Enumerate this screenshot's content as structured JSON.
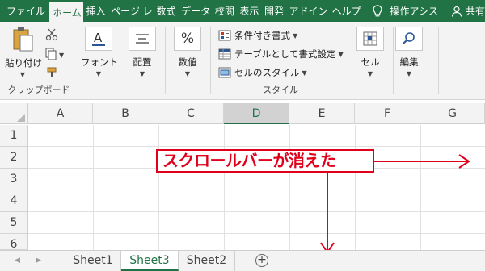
{
  "tabs": [
    {
      "label": "ファイル"
    },
    {
      "label": "ホーム"
    },
    {
      "label": "挿入"
    },
    {
      "label": "ページ レ"
    },
    {
      "label": "数式"
    },
    {
      "label": "データ"
    },
    {
      "label": "校閲"
    },
    {
      "label": "表示"
    },
    {
      "label": "開発"
    },
    {
      "label": "アドイン"
    },
    {
      "label": "ヘルプ"
    }
  ],
  "tell_me": "操作アシス",
  "share": "共有",
  "ribbon": {
    "clipboard": {
      "paste": "貼り付け",
      "label": "クリップボード"
    },
    "font": {
      "label": "フォント"
    },
    "alignment": {
      "label": "配置"
    },
    "number": {
      "label": "数値"
    },
    "styles": {
      "conditional": "条件付き書式",
      "table": "テーブルとして書式設定",
      "cell_styles": "セルのスタイル",
      "label": "スタイル"
    },
    "cells": {
      "label": "セル"
    },
    "editing": {
      "label": "編集"
    }
  },
  "columns": [
    "A",
    "B",
    "C",
    "D",
    "E",
    "F",
    "G"
  ],
  "selected_column": "D",
  "rows": [
    "1",
    "2",
    "3",
    "4",
    "5",
    "6"
  ],
  "annotation": "スクロールバーが消えた",
  "sheets": [
    {
      "name": "Sheet1"
    },
    {
      "name": "Sheet3"
    },
    {
      "name": "Sheet2"
    }
  ],
  "active_sheet": "Sheet3",
  "colors": {
    "accent": "#217346",
    "annotation": "#e0001b"
  }
}
